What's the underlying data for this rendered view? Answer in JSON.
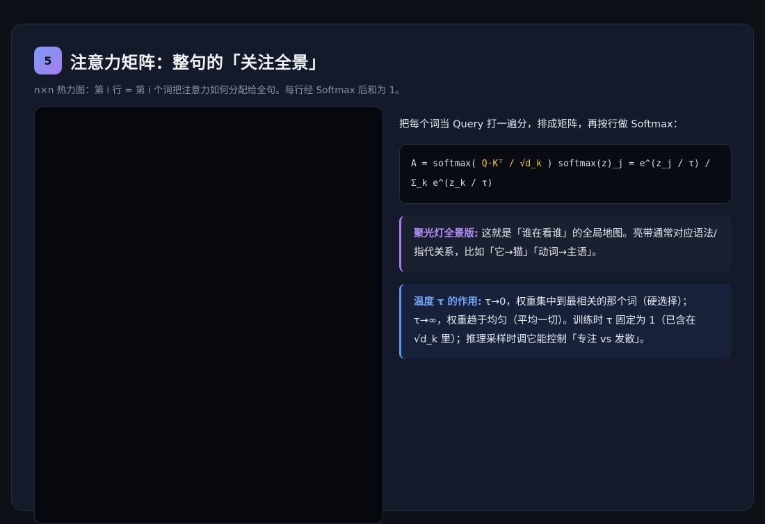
{
  "section": {
    "number": "5",
    "title": "注意力矩阵：整句的「关注全景」",
    "subtitle": "n×n 热力图：第 i 行 = 第 i 个词把注意力如何分配给全句。每行经 Softmax 后和为 1。"
  },
  "explain": {
    "intro": "把每个词当 Query 打一遍分，排成矩阵，再按行做 Softmax：",
    "formula": {
      "prefix": "A = softmax( ",
      "highlight": "Q·Kᵀ / √d_k",
      "suffix": " ) softmax(z)_j = e^(z_j / τ) / Σ_k e^(z_k / τ)"
    },
    "notes": [
      {
        "lead": "聚光灯全景版:",
        "text": " 这就是「谁在看谁」的全局地图。亮带通常对应语法/指代关系，比如「它→猫」「动词→主语」。"
      },
      {
        "lead": "温度 τ 的作用:",
        "text": " τ→0，权重集中到最相关的那个词（硬选择）；τ→∞，权重趋于均匀（平均一切）。训练时 τ 固定为 1（已含在 √d_k 里）；推理采样时调它能控制「专注 vs 发散」。"
      }
    ]
  },
  "colors": {
    "accent_purple": "#a57df0",
    "accent_blue": "#5d95f0",
    "formula_highlight": "#f2c24d"
  }
}
